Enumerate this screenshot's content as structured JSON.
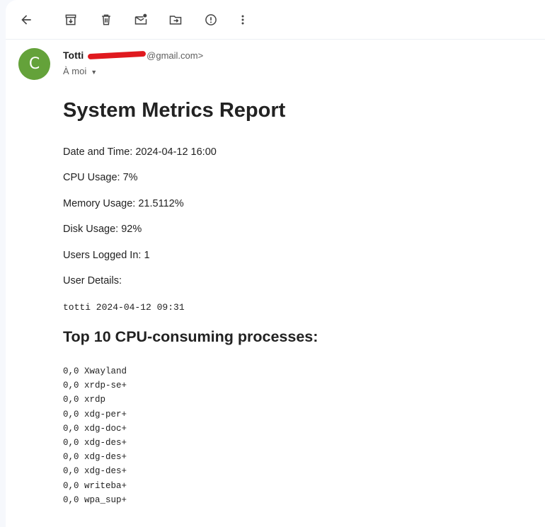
{
  "toolbar": {
    "icons": [
      "back-arrow-icon",
      "archive-icon",
      "trash-icon",
      "mark-unread-icon",
      "move-to-icon",
      "report-spam-icon",
      "more-vert-icon"
    ]
  },
  "sender": {
    "avatar_letter": "C",
    "avatar_color": "#64a23a",
    "name": "Totti",
    "email_suffix": "@gmail.com>",
    "redaction_color": "#e0191e",
    "recipient": "À moi"
  },
  "report": {
    "title": "System Metrics Report",
    "datetime": "Date and Time: 2024-04-12 16:00",
    "cpu": "CPU Usage: 7%",
    "memory": "Memory Usage: 21.5112%",
    "disk": "Disk Usage: 92%",
    "users_logged": "Users Logged In: 1",
    "user_details_label": "User Details:",
    "user_details_value": "totti 2024-04-12 09:31",
    "top_processes_title": "Top 10 CPU-consuming processes:",
    "processes": [
      "0,0 Xwayland",
      "0,0 xrdp-se+",
      "0,0 xrdp",
      "0,0 xdg-per+",
      "0,0 xdg-doc+",
      "0,0 xdg-des+",
      "0,0 xdg-des+",
      "0,0 xdg-des+",
      "0,0 writeba+",
      "0,0 wpa_sup+"
    ]
  }
}
